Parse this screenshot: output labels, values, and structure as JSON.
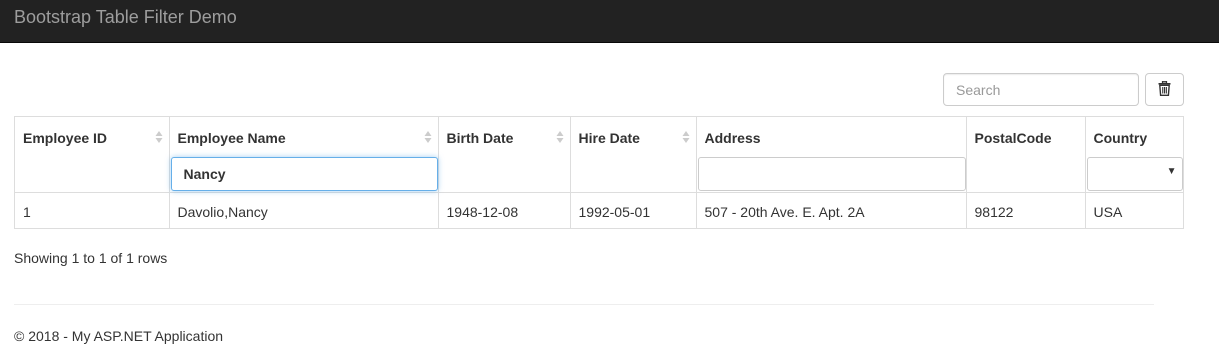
{
  "navbar": {
    "brand": "Bootstrap Table Filter Demo"
  },
  "toolbar": {
    "search_placeholder": "Search",
    "clear_icon": "trash-icon"
  },
  "table": {
    "columns": [
      {
        "label": "Employee ID",
        "sortable": true,
        "filter": "none"
      },
      {
        "label": "Employee Name",
        "sortable": true,
        "filter": "input",
        "filter_value": "Nancy"
      },
      {
        "label": "Birth Date",
        "sortable": true,
        "filter": "none"
      },
      {
        "label": "Hire Date",
        "sortable": true,
        "filter": "none"
      },
      {
        "label": "Address",
        "sortable": false,
        "filter": "input",
        "filter_value": ""
      },
      {
        "label": "PostalCode",
        "sortable": false,
        "filter": "none"
      },
      {
        "label": "Country",
        "sortable": false,
        "filter": "select",
        "filter_value": ""
      }
    ],
    "rows": [
      [
        "1",
        "Davolio,Nancy",
        "1948-12-08",
        "1992-05-01",
        "507 - 20th Ave. E. Apt. 2A",
        "98122",
        "USA"
      ]
    ]
  },
  "pagination": {
    "info": "Showing 1 to 1 of 1 rows"
  },
  "footer": {
    "text": "© 2018 - My ASP.NET Application"
  },
  "colors": {
    "navbar_bg": "#222222",
    "brand_text": "#9d9d9d",
    "focus_border": "#66afe9",
    "border": "#dddddd"
  }
}
